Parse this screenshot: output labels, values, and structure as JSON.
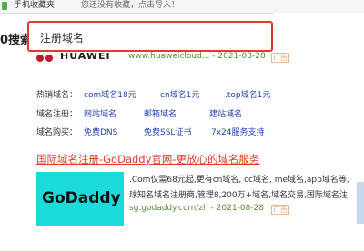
{
  "bookmarks": {
    "label": "手机收藏夹",
    "hint": "您还没有收藏，点击导入！"
  },
  "search": {
    "partial_label": "0搜索",
    "value": "注册域名"
  },
  "huawei": {
    "brand": "HUAWEI",
    "url": "www.huaweicloud... - 2021-08-28",
    "badge": "广告"
  },
  "rows": [
    {
      "label": "热销域名：",
      "links": [
        "com域名18元",
        "cn域名1元",
        ".top域名1元"
      ]
    },
    {
      "label": "域名注册：",
      "links": [
        "网站域名",
        "邮箱域名",
        "建站域名"
      ]
    },
    {
      "label": "域名购买：",
      "links": [
        "免费DNS",
        "免费SSL证书",
        "7x24服务支持"
      ]
    }
  ],
  "godaddy": {
    "title": "国际域名注册-GoDaddy官网-更放心的域名服务",
    "logo_text": "GoDaddy",
    "desc_line1": ".Com仅需68元起,更有cn域名, cc域名, me域名,app域名等,",
    "desc_line2": "球知名域名注册商,管理8,200万+域名,域名交易,国际域名注",
    "url": "sg.godaddy.com/zh - 2021-08-28",
    "badge": "广告"
  },
  "colors": {
    "accent_red": "#e03a2f",
    "link_blue": "#2440b3",
    "url_green": "#5a8a3a",
    "godaddy_bg": "#1bdbdb"
  }
}
